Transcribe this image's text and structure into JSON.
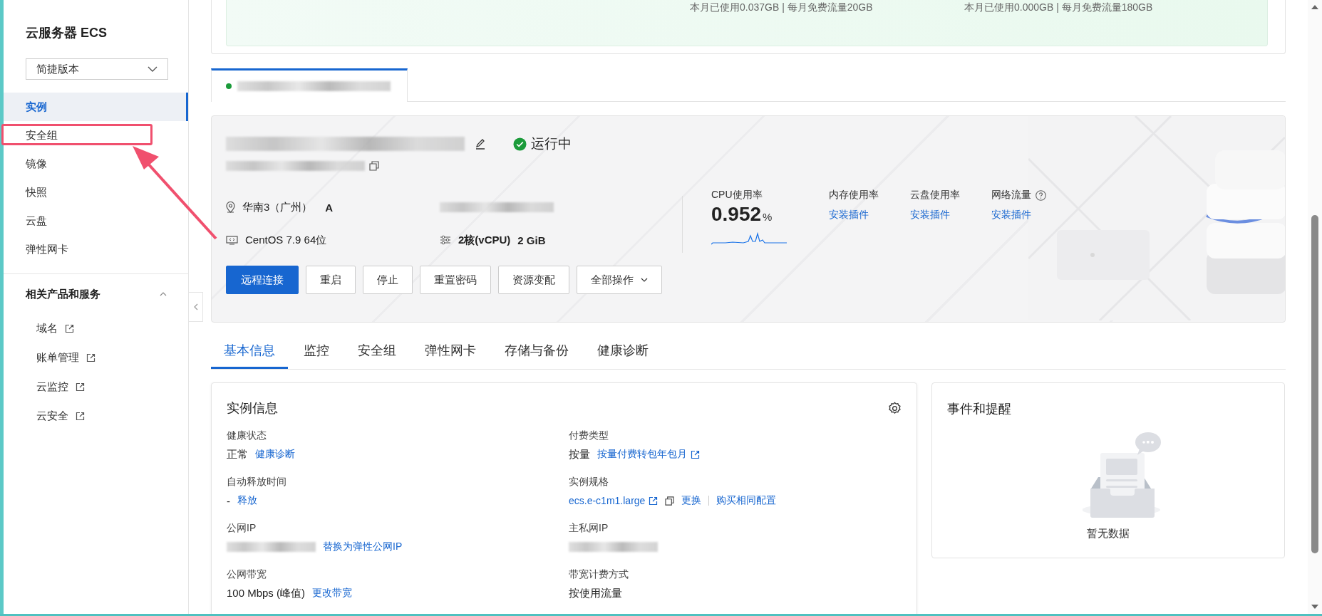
{
  "sidebar": {
    "title": "云服务器 ECS",
    "version_select": {
      "value": "简捷版本"
    },
    "items": [
      {
        "label": "实例",
        "selected": true,
        "highlighted": false
      },
      {
        "label": "安全组",
        "selected": false,
        "highlighted": true
      },
      {
        "label": "镜像",
        "selected": false,
        "highlighted": false
      },
      {
        "label": "快照",
        "selected": false,
        "highlighted": false
      },
      {
        "label": "云盘",
        "selected": false,
        "highlighted": false
      },
      {
        "label": "弹性网卡",
        "selected": false,
        "highlighted": false
      }
    ],
    "section": {
      "title": "相关产品和服务",
      "expanded": true,
      "links": [
        {
          "label": "域名"
        },
        {
          "label": "账单管理"
        },
        {
          "label": "云监控"
        },
        {
          "label": "云安全"
        }
      ]
    }
  },
  "traffic_card": {
    "usage": [
      "本月已使用0.037GB | 每月免费流量20GB",
      "本月已使用0.000GB | 每月免费流量180GB"
    ]
  },
  "instance": {
    "running": true,
    "status": "运行中",
    "region": "华南3（广州）",
    "zone": "A",
    "os": "CentOS 7.9 64位",
    "cpu": "2核(vCPU)",
    "memory": "2 GiB",
    "metrics": [
      {
        "label": "CPU使用率",
        "kind": "value",
        "value": "0.952",
        "unit": "%"
      },
      {
        "label": "内存使用率",
        "kind": "link",
        "link": "安装插件"
      },
      {
        "label": "云盘使用率",
        "kind": "link",
        "link": "安装插件"
      },
      {
        "label": "网络流量",
        "kind": "link",
        "help": true,
        "link": "安装插件"
      }
    ],
    "actions": [
      {
        "label": "远程连接",
        "primary": true
      },
      {
        "label": "重启",
        "primary": false
      },
      {
        "label": "停止",
        "primary": false
      },
      {
        "label": "重置密码",
        "primary": false
      },
      {
        "label": "资源变配",
        "primary": false
      },
      {
        "label": "全部操作",
        "primary": false,
        "dropdown": true
      }
    ]
  },
  "detail_tabs": [
    {
      "label": "基本信息",
      "selected": true
    },
    {
      "label": "监控",
      "selected": false
    },
    {
      "label": "安全组",
      "selected": false
    },
    {
      "label": "弹性网卡",
      "selected": false
    },
    {
      "label": "存储与备份",
      "selected": false
    },
    {
      "label": "健康诊断",
      "selected": false
    }
  ],
  "info_card": {
    "title": "实例信息",
    "fields": [
      {
        "label": "健康状态",
        "parts": [
          {
            "kind": "text",
            "text": "正常"
          },
          {
            "kind": "link",
            "text": "健康诊断"
          }
        ]
      },
      {
        "label": "付费类型",
        "parts": [
          {
            "kind": "text",
            "text": "按量"
          },
          {
            "kind": "external",
            "text": "按量付费转包年包月"
          }
        ]
      },
      {
        "label": "自动释放时间",
        "parts": [
          {
            "kind": "text",
            "text": "-"
          },
          {
            "kind": "link",
            "text": "释放"
          }
        ]
      },
      {
        "label": "实例规格",
        "parts": [
          {
            "kind": "external",
            "text": "ecs.e-c1m1.large"
          },
          {
            "kind": "copy"
          },
          {
            "kind": "link",
            "text": "更换"
          },
          {
            "kind": "separator"
          },
          {
            "kind": "link",
            "text": "购买相同配置"
          }
        ]
      },
      {
        "label": "公网IP",
        "parts": [
          {
            "kind": "blurred"
          },
          {
            "kind": "link",
            "text": "替换为弹性公网IP"
          }
        ]
      },
      {
        "label": "主私网IP",
        "parts": [
          {
            "kind": "blurred"
          }
        ]
      },
      {
        "label": "公网带宽",
        "parts": [
          {
            "kind": "text",
            "text": "100 Mbps (峰值)"
          },
          {
            "kind": "link",
            "text": "更改带宽"
          }
        ]
      },
      {
        "label": "带宽计费方式",
        "parts": [
          {
            "kind": "text",
            "text": "按使用流量"
          }
        ]
      }
    ]
  },
  "events_card": {
    "title": "事件和提醒",
    "empty_text": "暂无数据"
  }
}
